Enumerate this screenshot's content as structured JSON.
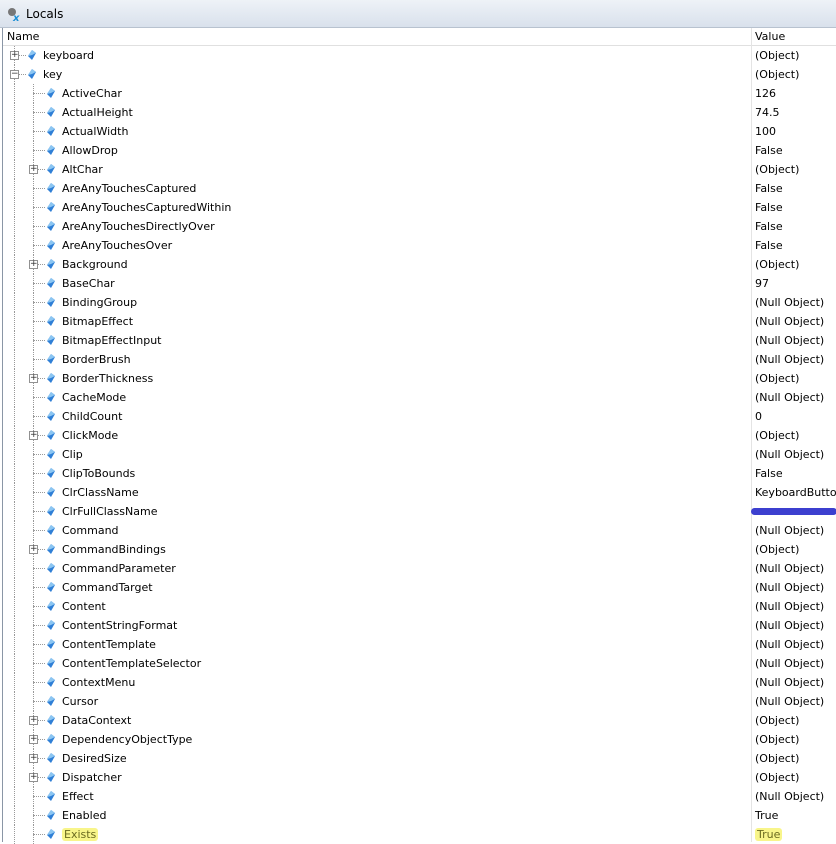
{
  "window": {
    "title": "Locals",
    "icon": "locals-debug-icon"
  },
  "columns": {
    "name": "Name",
    "value": "Value"
  },
  "colors": {
    "highlight": "#f8f58a",
    "redaction": "#3c3fcf",
    "gem": "#2f7fd6"
  },
  "rows": [
    {
      "name": "keyboard",
      "value": "(Object)",
      "level": 0,
      "expander": "plus"
    },
    {
      "name": "key",
      "value": "(Object)",
      "level": 0,
      "expander": "minus"
    },
    {
      "name": "ActiveChar",
      "value": "126",
      "level": 1
    },
    {
      "name": "ActualHeight",
      "value": "74.5",
      "level": 1
    },
    {
      "name": "ActualWidth",
      "value": "100",
      "level": 1
    },
    {
      "name": "AllowDrop",
      "value": "False",
      "level": 1
    },
    {
      "name": "AltChar",
      "value": "(Object)",
      "level": 1,
      "expander": "plus"
    },
    {
      "name": "AreAnyTouchesCaptured",
      "value": "False",
      "level": 1
    },
    {
      "name": "AreAnyTouchesCapturedWithin",
      "value": "False",
      "level": 1
    },
    {
      "name": "AreAnyTouchesDirectlyOver",
      "value": "False",
      "level": 1
    },
    {
      "name": "AreAnyTouchesOver",
      "value": "False",
      "level": 1
    },
    {
      "name": "Background",
      "value": "(Object)",
      "level": 1,
      "expander": "plus"
    },
    {
      "name": "BaseChar",
      "value": "97",
      "level": 1
    },
    {
      "name": "BindingGroup",
      "value": "(Null Object)",
      "level": 1
    },
    {
      "name": "BitmapEffect",
      "value": "(Null Object)",
      "level": 1
    },
    {
      "name": "BitmapEffectInput",
      "value": "(Null Object)",
      "level": 1
    },
    {
      "name": "BorderBrush",
      "value": "(Null Object)",
      "level": 1
    },
    {
      "name": "BorderThickness",
      "value": "(Object)",
      "level": 1,
      "expander": "plus"
    },
    {
      "name": "CacheMode",
      "value": "(Null Object)",
      "level": 1
    },
    {
      "name": "ChildCount",
      "value": "0",
      "level": 1
    },
    {
      "name": "ClickMode",
      "value": "(Object)",
      "level": 1,
      "expander": "plus"
    },
    {
      "name": "Clip",
      "value": "(Null Object)",
      "level": 1
    },
    {
      "name": "ClipToBounds",
      "value": "False",
      "level": 1
    },
    {
      "name": "ClrClassName",
      "value": "KeyboardButton",
      "level": 1
    },
    {
      "name": "ClrFullClassName",
      "value": "",
      "level": 1,
      "redacted": true
    },
    {
      "name": "Command",
      "value": "(Null Object)",
      "level": 1
    },
    {
      "name": "CommandBindings",
      "value": "(Object)",
      "level": 1,
      "expander": "plus"
    },
    {
      "name": "CommandParameter",
      "value": "(Null Object)",
      "level": 1
    },
    {
      "name": "CommandTarget",
      "value": "(Null Object)",
      "level": 1
    },
    {
      "name": "Content",
      "value": "(Null Object)",
      "level": 1
    },
    {
      "name": "ContentStringFormat",
      "value": "(Null Object)",
      "level": 1
    },
    {
      "name": "ContentTemplate",
      "value": "(Null Object)",
      "level": 1
    },
    {
      "name": "ContentTemplateSelector",
      "value": "(Null Object)",
      "level": 1
    },
    {
      "name": "ContextMenu",
      "value": "(Null Object)",
      "level": 1
    },
    {
      "name": "Cursor",
      "value": "(Null Object)",
      "level": 1
    },
    {
      "name": "DataContext",
      "value": "(Object)",
      "level": 1,
      "expander": "plus"
    },
    {
      "name": "DependencyObjectType",
      "value": "(Object)",
      "level": 1,
      "expander": "plus"
    },
    {
      "name": "DesiredSize",
      "value": "(Object)",
      "level": 1,
      "expander": "plus"
    },
    {
      "name": "Dispatcher",
      "value": "(Object)",
      "level": 1,
      "expander": "plus"
    },
    {
      "name": "Effect",
      "value": "(Null Object)",
      "level": 1
    },
    {
      "name": "Enabled",
      "value": "True",
      "level": 1
    },
    {
      "name": "Exists",
      "value": "True",
      "level": 1,
      "highlighted": true
    }
  ]
}
